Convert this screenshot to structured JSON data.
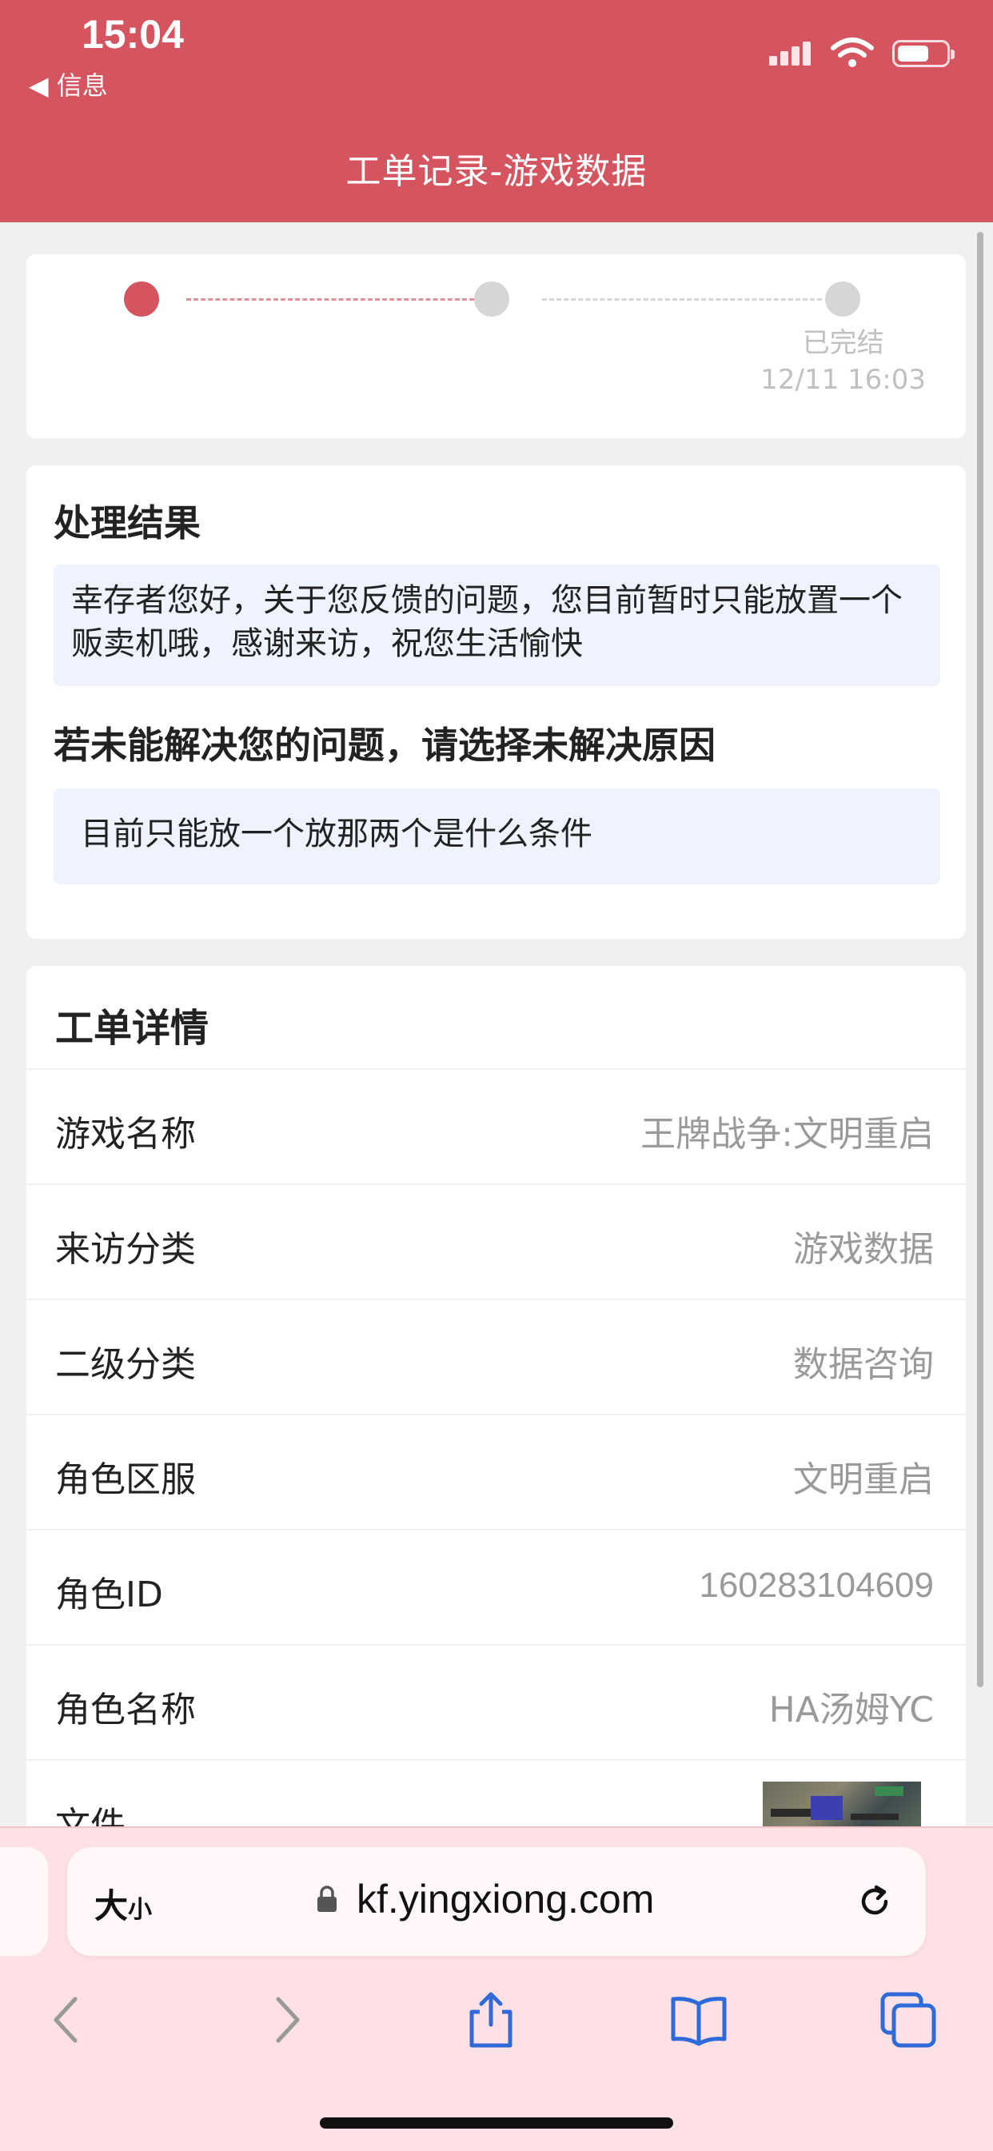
{
  "status_bar": {
    "time": "15:04",
    "back_label": "◀ 信息",
    "signal_icon": "cellular-signal-icon",
    "wifi_icon": "wifi-icon",
    "battery_icon": "battery-icon"
  },
  "header": {
    "title": "工单记录-游戏数据"
  },
  "progress": {
    "current_step": 1,
    "last_step_label": "已完结",
    "last_step_time": "12/11 16:03"
  },
  "result": {
    "title": "处理结果",
    "message": "幸存者您好，关于您反馈的问题，您目前暂时只能放置一个贩卖机哦，感谢来访，祝您生活愉快",
    "unresolved_title": "若未能解决您的问题，请选择未解决原因",
    "unresolved_reason": "目前只能放一个放那两个是什么条件"
  },
  "details": {
    "title": "工单详情",
    "rows": [
      {
        "key": "游戏名称",
        "value": "王牌战争:文明重启"
      },
      {
        "key": "来访分类",
        "value": "游戏数据"
      },
      {
        "key": "二级分类",
        "value": "数据咨询"
      },
      {
        "key": "角色区服",
        "value": "文明重启"
      },
      {
        "key": "角色ID",
        "value": "160283104609"
      },
      {
        "key": "角色名称",
        "value": "HA汤姆YC"
      },
      {
        "key": "文件",
        "value": ""
      }
    ]
  },
  "browser": {
    "text_size_label": "大",
    "text_size_small": "小",
    "url": "kf.yingxiong.com",
    "lock_icon": "lock-icon",
    "reload_icon": "reload-icon",
    "nav": [
      "back-arrow-icon",
      "forward-arrow-icon",
      "share-icon",
      "bookmarks-icon",
      "tabs-icon"
    ]
  },
  "colors": {
    "accent": "#d4545f",
    "blue_box": "#eef3fd",
    "safari_bar": "#fde1e4"
  }
}
